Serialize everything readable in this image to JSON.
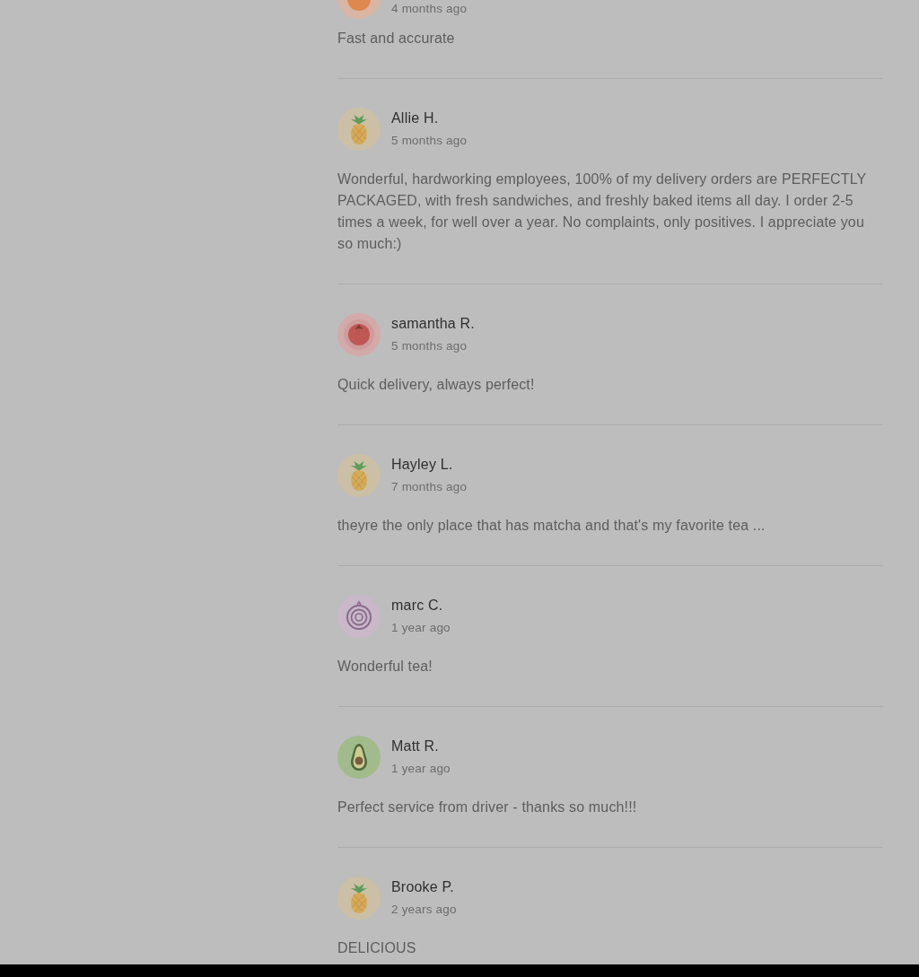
{
  "reviews": [
    {
      "avatar": {
        "kind": "orange"
      },
      "time": "4 months ago",
      "text": "Fast and accurate"
    },
    {
      "avatar": {
        "kind": "pineapple"
      },
      "name": "Allie H.",
      "time": "5 months ago",
      "text": "Wonderful, hardworking employees, 100% of my delivery orders are PERFECTLY PACKAGED, with fresh sandwiches, and freshly baked items all day. I order 2-5 times a week, for well over a year. No complaints, only positives. I appreciate you so much:)"
    },
    {
      "avatar": {
        "kind": "tomato"
      },
      "name": "samantha R.",
      "time": "5 months ago",
      "text": "Quick delivery, always perfect!"
    },
    {
      "avatar": {
        "kind": "pineapple"
      },
      "name": "Hayley L.",
      "time": "7 months ago",
      "text": "theyre the only place that has matcha and that's my favorite tea ..."
    },
    {
      "avatar": {
        "kind": "onion"
      },
      "name": "marc C.",
      "time": "1 year ago",
      "text": "Wonderful tea!"
    },
    {
      "avatar": {
        "kind": "avocado"
      },
      "name": "Matt R.",
      "time": "1 year ago",
      "text": "Perfect service from driver - thanks so much!!!"
    },
    {
      "avatar": {
        "kind": "pineapple"
      },
      "name": "Brooke P.",
      "time": "2 years ago",
      "text": "DELICIOUS"
    }
  ]
}
